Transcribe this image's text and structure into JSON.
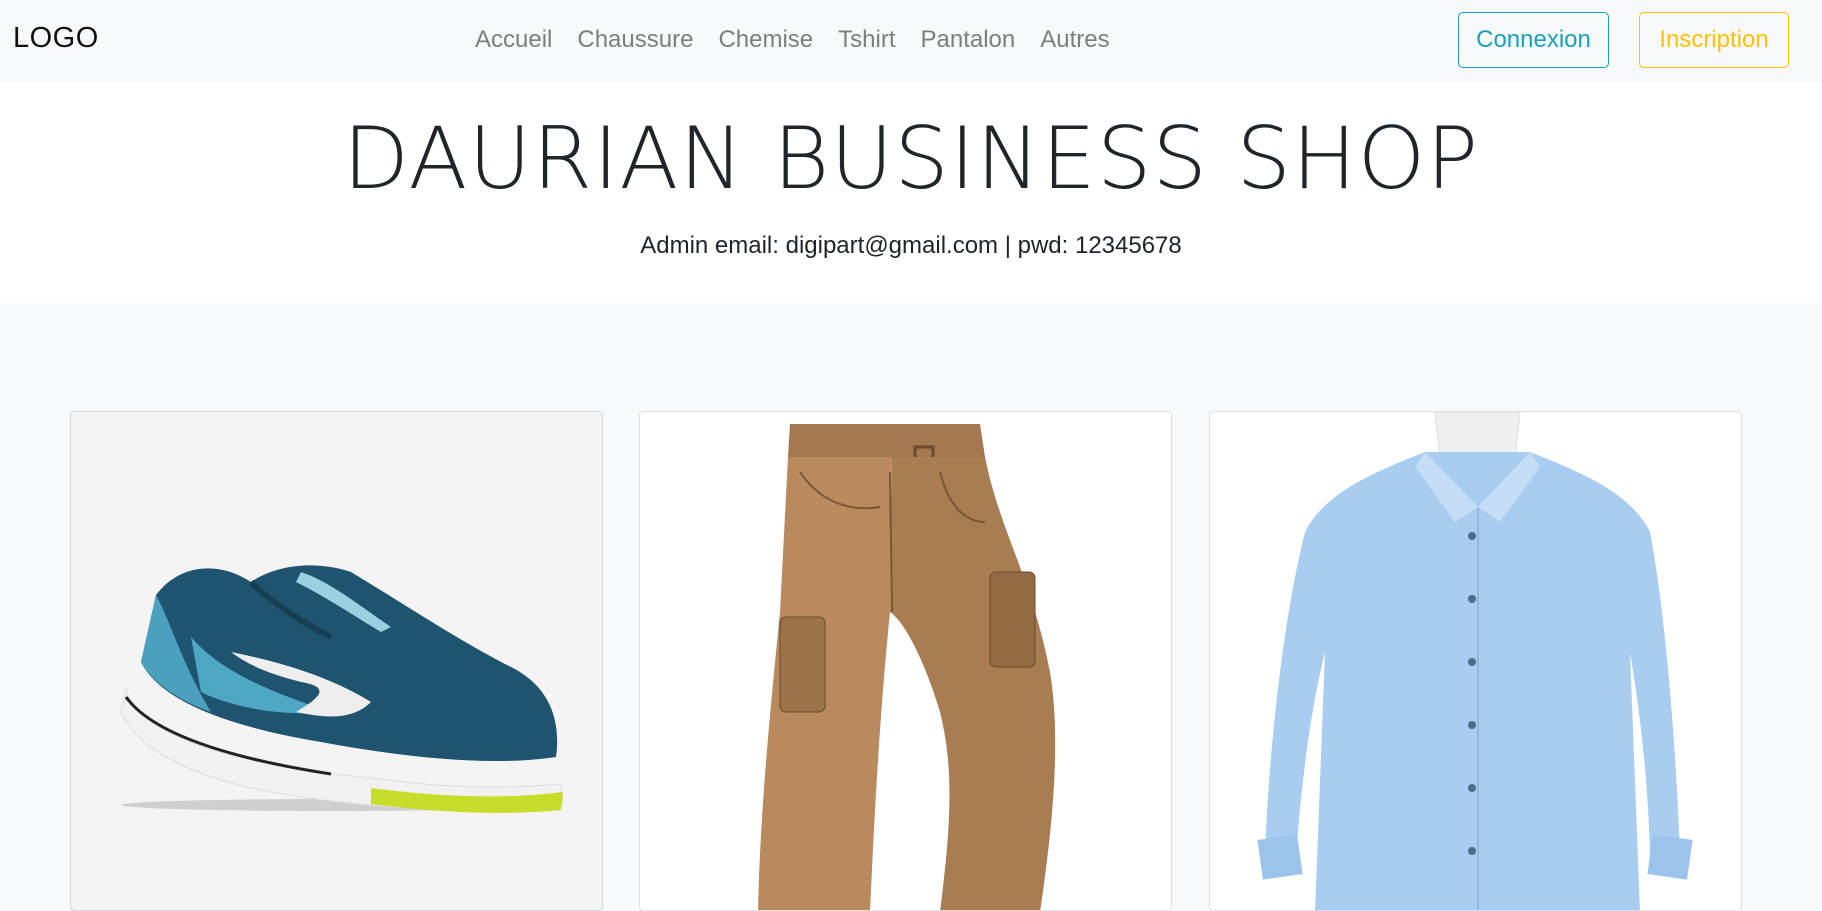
{
  "header": {
    "logo": "LOGO",
    "nav": [
      "Accueil",
      "Chaussure",
      "Chemise",
      "Tshirt",
      "Pantalon",
      "Autres"
    ],
    "connexion_label": "Connexion",
    "inscription_label": "Inscription"
  },
  "hero": {
    "title": "DAURIAN BUSINESS SHOP",
    "subtitle": "Admin email: digipart@gmail.com | pwd: 12345678"
  },
  "products": [
    {
      "image": "sneaker-image"
    },
    {
      "image": "cargo-pants-image"
    },
    {
      "image": "blue-shirt-image"
    }
  ],
  "colors": {
    "info": "#17a2b8",
    "warning": "#ffc107",
    "nav_text": "#7b7f84",
    "light_bg": "#f8f9fa"
  }
}
